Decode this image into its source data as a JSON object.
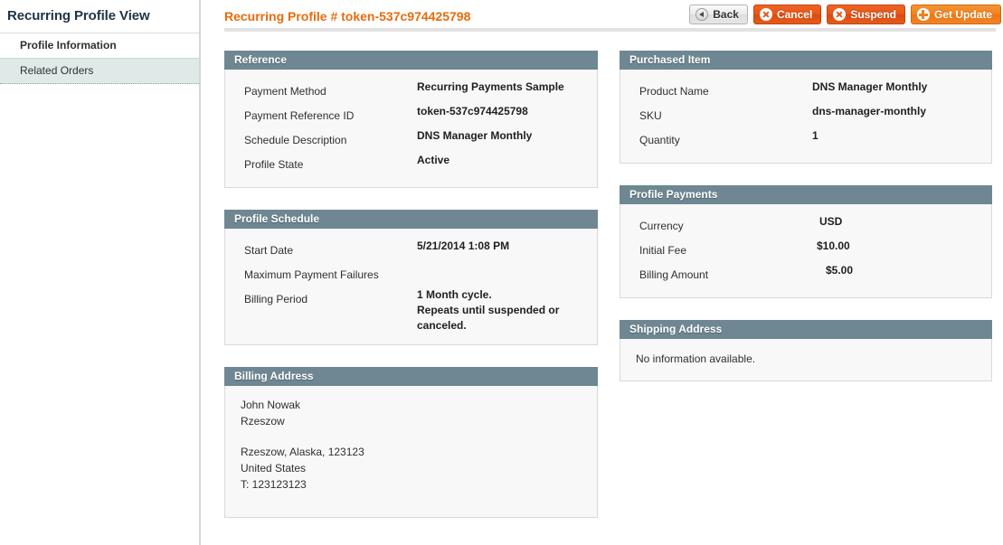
{
  "sidebar": {
    "title": "Recurring Profile View",
    "items": [
      {
        "label": "Profile Information",
        "state": "active"
      },
      {
        "label": "Related Orders",
        "state": "selected"
      }
    ]
  },
  "header": {
    "title": "Recurring Profile # token-537c974425798",
    "accent_color": "#eb6a0a",
    "buttons": [
      {
        "label": "Back",
        "icon": "back-arrow-icon",
        "style": "back"
      },
      {
        "label": "Cancel",
        "icon": "close-circle-icon",
        "style": "red"
      },
      {
        "label": "Suspend",
        "icon": "close-circle-icon",
        "style": "red"
      },
      {
        "label": "Get Update",
        "icon": "plus-circle-icon",
        "style": "orange"
      }
    ]
  },
  "panels": {
    "header_color": "#6e8792",
    "reference": {
      "title": "Reference",
      "rows": [
        {
          "label": "Payment Method",
          "value": "Recurring Payments Sample"
        },
        {
          "label": "Payment Reference ID",
          "value": "token-537c974425798"
        },
        {
          "label": "Schedule Description",
          "value": "DNS Manager Monthly"
        },
        {
          "label": "Profile State",
          "value": "Active"
        }
      ]
    },
    "purchased_item": {
      "title": "Purchased Item",
      "rows": [
        {
          "label": "Product Name",
          "value": "DNS Manager Monthly"
        },
        {
          "label": "SKU",
          "value": "dns-manager-monthly"
        },
        {
          "label": "Quantity",
          "value": "1"
        }
      ]
    },
    "profile_schedule": {
      "title": "Profile Schedule",
      "rows": [
        {
          "label": "Start Date",
          "value": "5/21/2014 1:08 PM"
        },
        {
          "label": "Maximum Payment Failures",
          "value": ""
        },
        {
          "label": "Billing Period",
          "value": "1 Month cycle.\nRepeats until suspended or canceled."
        }
      ]
    },
    "profile_payments": {
      "title": "Profile Payments",
      "rows": [
        {
          "label": "Currency",
          "value": "USD"
        },
        {
          "label": "Initial Fee",
          "value": "$10.00"
        },
        {
          "label": "Billing Amount",
          "value": "$5.00"
        }
      ]
    },
    "billing_address": {
      "title": "Billing Address",
      "name_lines": "John Nowak\nRzeszow",
      "address_lines": "Rzeszow, Alaska, 123123\nUnited States\nT: 123123123"
    },
    "shipping_address": {
      "title": "Shipping Address",
      "empty_text": "No information available."
    }
  }
}
